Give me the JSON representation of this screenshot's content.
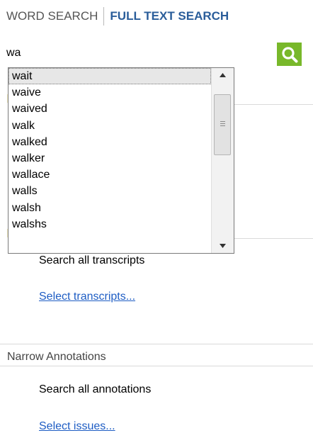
{
  "tabs": {
    "word_search": "WORD SEARCH",
    "full_text_search": "FULL TEXT SEARCH"
  },
  "search": {
    "value": "wa"
  },
  "autocomplete": {
    "items": [
      "wait",
      "waive",
      "waived",
      "walk",
      "walked",
      "walker",
      "wallace",
      "walls",
      "walsh",
      "walshs"
    ],
    "selected": "wait"
  },
  "transcripts": {
    "all_text": "Search all transcripts",
    "select_link": "Select transcripts..."
  },
  "annotations": {
    "heading": "Narrow Annotations",
    "all_text": "Search all annotations",
    "select_link": "Select issues..."
  },
  "icons": {
    "search": "search-icon",
    "scroll_up": "scroll-up-arrow-icon",
    "scroll_down": "scroll-down-arrow-icon"
  },
  "colors": {
    "accent_green": "#78b82a",
    "tab_active": "#2a5d9a",
    "link": "#1e5dc4"
  }
}
